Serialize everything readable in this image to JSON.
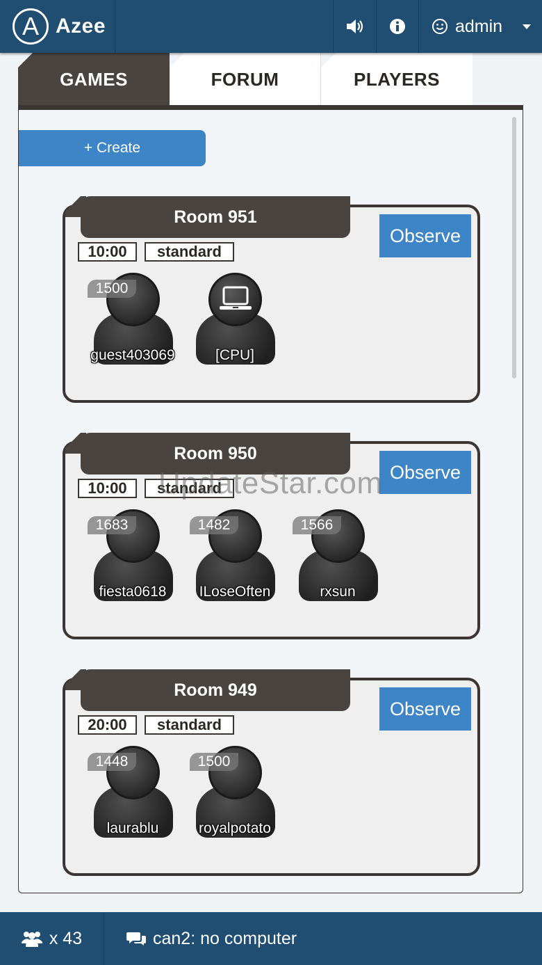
{
  "header": {
    "brand_mark": "A",
    "brand_name": "Azee",
    "user_name": "admin"
  },
  "tabs": [
    {
      "label": "GAMES",
      "active": true
    },
    {
      "label": "FORUM",
      "active": false
    },
    {
      "label": "PLAYERS",
      "active": false
    }
  ],
  "create_label": "+ Create",
  "observe_label": "Observe",
  "rooms": [
    {
      "title": "Room 951",
      "time_control": "10:00",
      "mode": "standard",
      "players": [
        {
          "rating": "1500",
          "name": "guest403069"
        },
        {
          "name": "[CPU]",
          "icon": "laptop-icon"
        }
      ]
    },
    {
      "title": "Room 950",
      "time_control": "10:00",
      "mode": "standard",
      "players": [
        {
          "rating": "1683",
          "name": "fiesta0618"
        },
        {
          "rating": "1482",
          "name": "ILoseOften"
        },
        {
          "rating": "1566",
          "name": "rxsun"
        }
      ]
    },
    {
      "title": "Room 949",
      "time_control": "20:00",
      "mode": "standard",
      "players": [
        {
          "rating": "1448",
          "name": "laurablu"
        },
        {
          "rating": "1500",
          "name": "royalpotato"
        }
      ]
    }
  ],
  "footer": {
    "online_count": "x 43",
    "chat_message": "can2: no computer"
  },
  "watermark": "UpdateStar.com",
  "colors": {
    "header_bg": "#1f4e72",
    "accent_blue": "#3d85c6",
    "dark_brown": "#4a4441"
  }
}
